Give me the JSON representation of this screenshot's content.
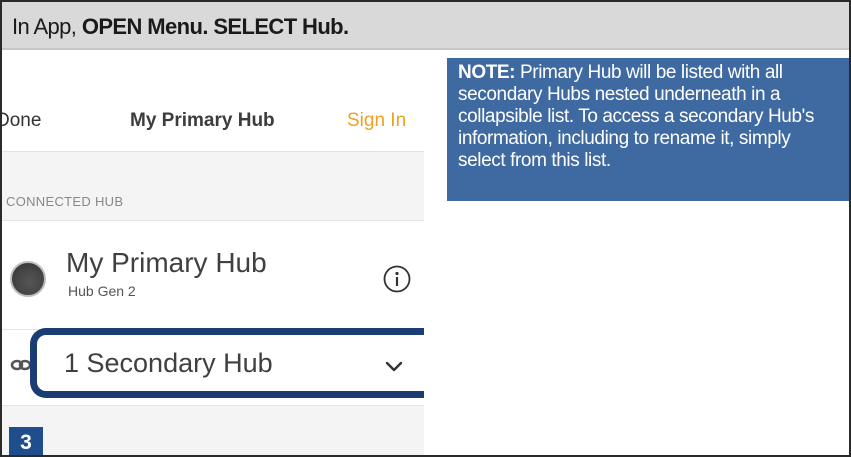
{
  "instruction": {
    "prefix": "In App, ",
    "bold": "OPEN Menu. SELECT Hub."
  },
  "phone": {
    "header": {
      "done_label": "Done",
      "title": "My Primary Hub",
      "signin_label": "Sign In"
    },
    "section_label": "CONNECTED HUB",
    "hub": {
      "name": "My Primary Hub",
      "subtitle": "Hub Gen 2"
    },
    "secondary": {
      "label": "1 Secondary Hub"
    },
    "step_number": "3"
  },
  "note": {
    "heading": "NOTE:",
    "body": " Primary Hub will be listed with all secondary Hubs nested underneath in a collapsible list.  To access a secondary Hub's information, including to rename it, simply select from this list."
  },
  "colors": {
    "accent_blue": "#1a3e74",
    "note_bg": "#3f6aa1",
    "signin_orange": "#f0a020"
  },
  "icons": [
    "hub-status-icon",
    "info-icon",
    "link-icon",
    "chevron-down-icon"
  ]
}
